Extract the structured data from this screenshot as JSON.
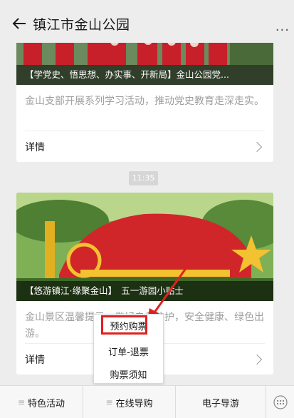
{
  "window": {
    "controls": [
      "pin-icon",
      "minimize-icon",
      "maximize-icon",
      "close-icon"
    ]
  },
  "header": {
    "title": "镇江市金山公园",
    "back_icon": "back-arrow-icon",
    "more_icon": "more-dots-icon",
    "more_label": "···"
  },
  "articles": [
    {
      "cover_caption": "【学党史、悟思想、办实事、开新局】金山公园党...",
      "summary": "金山支部开展系列学习活动，推动党史教育走深走实。",
      "detail_label": "详情"
    },
    {
      "cover_caption": "【悠游镇江·缘聚金山】　五一游园小贴士",
      "summary": "金山景区温馨提示，做好自身防护，安全健康、绿色出游。",
      "detail_label": "详情"
    }
  ],
  "timestamp": "11:35",
  "popup_menu": {
    "items": [
      "预约购票",
      "订单-退票",
      "购票须知"
    ],
    "highlighted": "预约购票",
    "highlight_color": "#e02020"
  },
  "bottom_menu": {
    "items": [
      "特色活动",
      "在线导购",
      "电子导游"
    ],
    "keyboard_icon": "keyboard-icon"
  }
}
